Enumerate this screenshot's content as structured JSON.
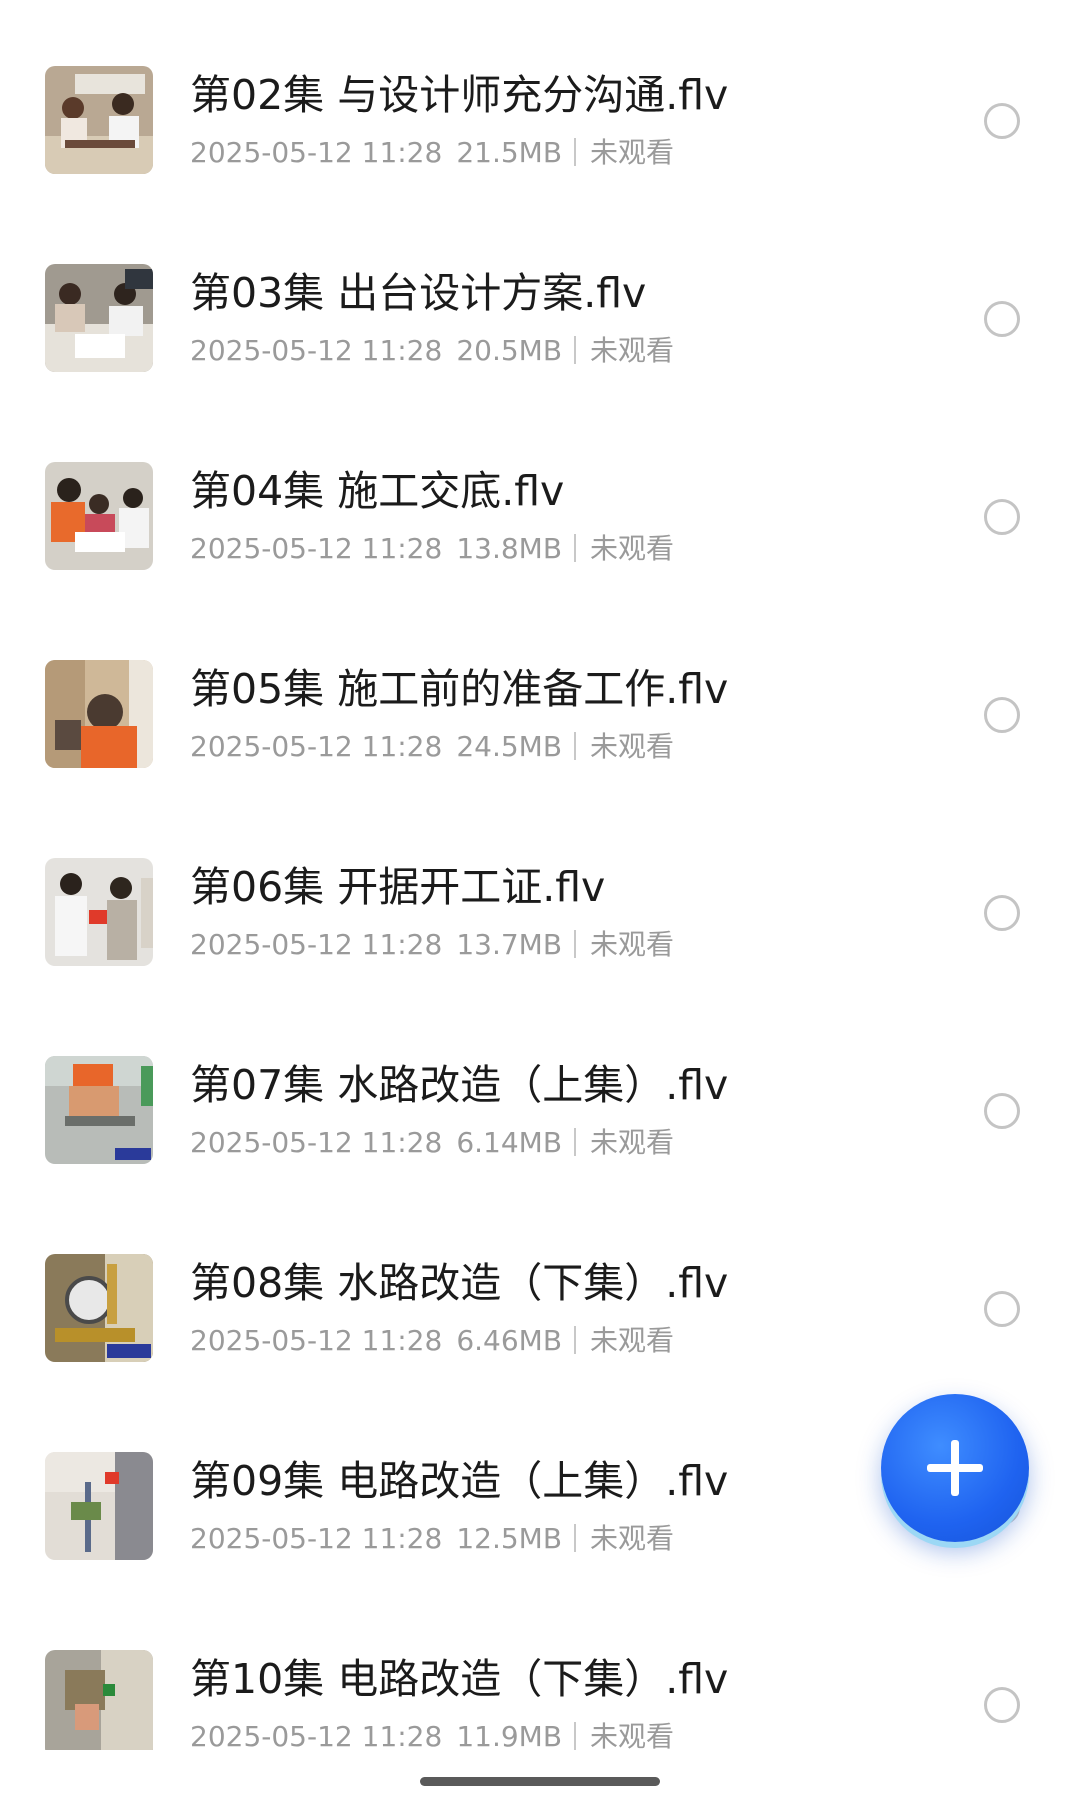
{
  "colors": {
    "fab": "#1f63f0",
    "title_text": "#1b1b1b",
    "meta_text": "#9a9a9a"
  },
  "files": [
    {
      "title": "第02集 与设计师充分沟通.flv",
      "date": "2025-05-12 11:28",
      "size": "21.5MB",
      "status": "未观看"
    },
    {
      "title": "第03集 出台设计方案.flv",
      "date": "2025-05-12 11:28",
      "size": "20.5MB",
      "status": "未观看"
    },
    {
      "title": "第04集 施工交底.flv",
      "date": "2025-05-12 11:28",
      "size": "13.8MB",
      "status": "未观看"
    },
    {
      "title": "第05集 施工前的准备工作.flv",
      "date": "2025-05-12 11:28",
      "size": "24.5MB",
      "status": "未观看"
    },
    {
      "title": "第06集 开据开工证.flv",
      "date": "2025-05-12 11:28",
      "size": "13.7MB",
      "status": "未观看"
    },
    {
      "title": "第07集 水路改造（上集）.flv",
      "date": "2025-05-12 11:28",
      "size": "6.14MB",
      "status": "未观看"
    },
    {
      "title": "第08集 水路改造（下集）.flv",
      "date": "2025-05-12 11:28",
      "size": "6.46MB",
      "status": "未观看"
    },
    {
      "title": "第09集 电路改造（上集）.flv",
      "date": "2025-05-12 11:28",
      "size": "12.5MB",
      "status": "未观看"
    },
    {
      "title": "第10集 电路改造（下集）.flv",
      "date": "2025-05-12 11:28",
      "size": "11.9MB",
      "status": "未观看"
    }
  ],
  "fab": {
    "icon": "plus-icon"
  }
}
